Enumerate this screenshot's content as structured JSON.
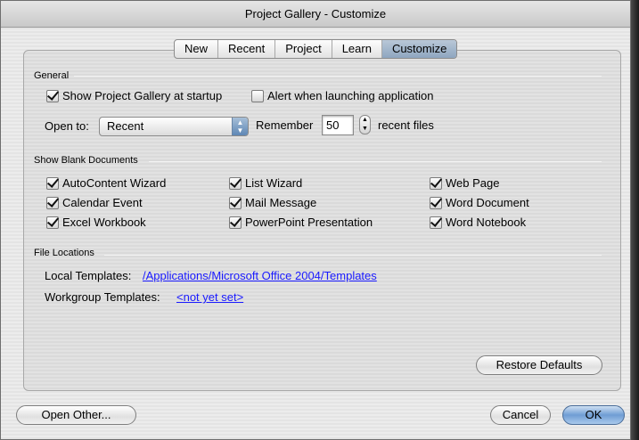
{
  "window": {
    "title": "Project Gallery - Customize"
  },
  "tabs": [
    {
      "label": "New"
    },
    {
      "label": "Recent"
    },
    {
      "label": "Project"
    },
    {
      "label": "Learn"
    },
    {
      "label": "Customize"
    }
  ],
  "general": {
    "heading": "General",
    "show_gallery": {
      "label": "Show Project Gallery at startup",
      "checked": true
    },
    "alert_launching": {
      "label": "Alert when launching application",
      "checked": false
    },
    "open_to_label": "Open to:",
    "open_to_value": "Recent",
    "remember_label": "Remember",
    "remember_value": "50",
    "recent_files_label": "recent files"
  },
  "blank_docs": {
    "heading": "Show Blank Documents",
    "items": [
      {
        "label": "AutoContent Wizard",
        "checked": true
      },
      {
        "label": "List Wizard",
        "checked": true
      },
      {
        "label": "Web Page",
        "checked": true
      },
      {
        "label": "Calendar Event",
        "checked": true
      },
      {
        "label": "Mail Message",
        "checked": true
      },
      {
        "label": "Word Document",
        "checked": true
      },
      {
        "label": "Excel Workbook",
        "checked": true
      },
      {
        "label": "PowerPoint Presentation",
        "checked": true
      },
      {
        "label": "Word Notebook",
        "checked": true
      }
    ]
  },
  "file_locations": {
    "heading": "File Locations",
    "local_label": "Local Templates:",
    "local_path": "/Applications/Microsoft Office 2004/Templates",
    "workgroup_label": "Workgroup Templates:",
    "workgroup_path": "<not yet set>"
  },
  "buttons": {
    "restore": "Restore Defaults",
    "open_other": "Open Other...",
    "cancel": "Cancel",
    "ok": "OK"
  },
  "icons": {
    "popup_arrows": "updown-arrows-icon",
    "stepper": "stepper-icon",
    "checkmark": "checkmark-icon"
  },
  "colors": {
    "link": "#1a1aff",
    "accent": "#6f9dd4"
  }
}
